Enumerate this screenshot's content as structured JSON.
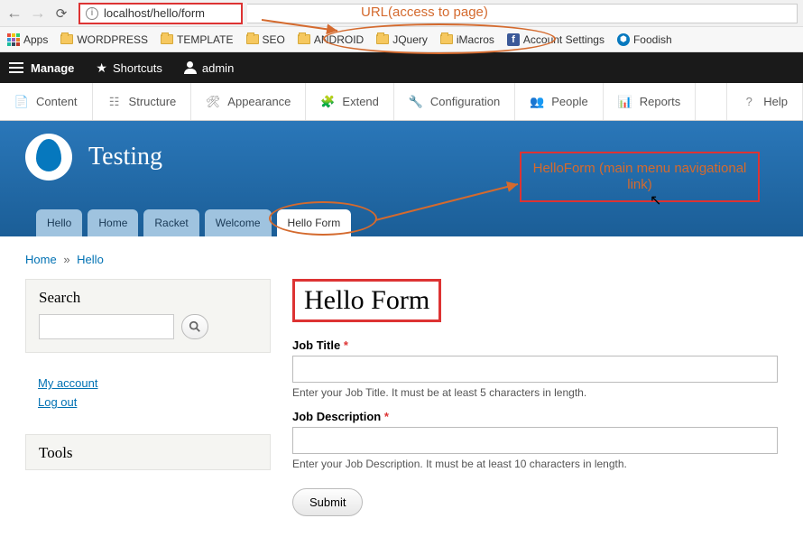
{
  "browser": {
    "url": "localhost/hello/form"
  },
  "bookmarks": {
    "apps": "Apps",
    "items": [
      "WORDPRESS",
      "TEMPLATE",
      "SEO",
      "ANDROID",
      "JQuery",
      "iMacros"
    ],
    "account": "Account Settings",
    "foodish": "Foodish"
  },
  "toolbar": {
    "manage": "Manage",
    "shortcuts": "Shortcuts",
    "admin": "admin"
  },
  "admin_menu": {
    "content": "Content",
    "structure": "Structure",
    "appearance": "Appearance",
    "extend": "Extend",
    "configuration": "Configuration",
    "people": "People",
    "reports": "Reports",
    "help": "Help"
  },
  "site": {
    "name": "Testing"
  },
  "tabs": [
    "Hello",
    "Home",
    "Racket",
    "Welcome",
    "Hello Form"
  ],
  "breadcrumb": {
    "home": "Home",
    "hello": "Hello"
  },
  "sidebar": {
    "search": {
      "title": "Search"
    },
    "user": {
      "account": "My account",
      "logout": "Log out"
    },
    "tools": {
      "title": "Tools"
    }
  },
  "form": {
    "title": "Hello Form",
    "job_title_label": "Job Title",
    "job_title_desc": "Enter your Job Title. It must be at least 5 characters in length.",
    "job_desc_label": "Job Description",
    "job_desc_desc": "Enter your Job Description. It must be at least 10 characters in length.",
    "submit": "Submit"
  },
  "annot": {
    "url": "URL(access to page)",
    "helloform": "HelloForm (main menu navigational link)"
  }
}
